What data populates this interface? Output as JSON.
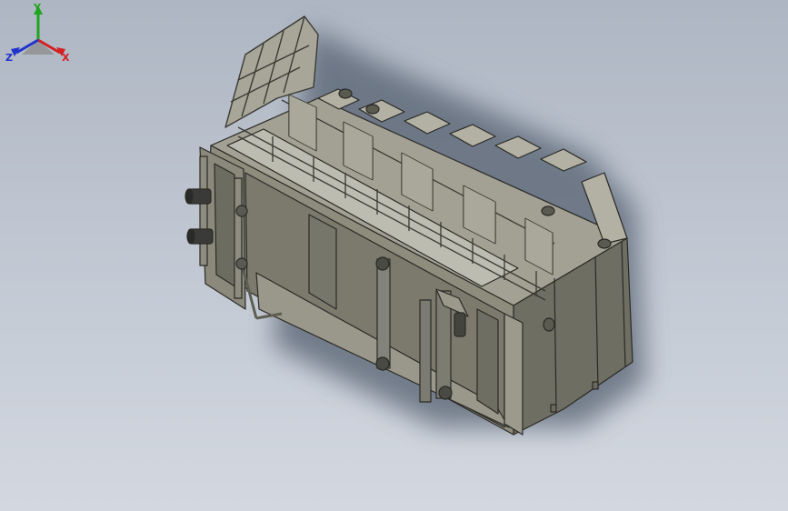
{
  "app": {
    "view_mode": "isometric-shaded-with-edges",
    "model_description_colors": {
      "tank_body": "#8e8c7d",
      "tank_dark": "#6a6a5e",
      "tank_light": "#b7b6a9",
      "outline": "#2a2a26",
      "shadow": "#56606f"
    }
  },
  "triad": {
    "x_label": "X",
    "y_label": "Y",
    "z_label": "Z",
    "x_color": "#d42020",
    "y_color": "#1fa51f",
    "z_color": "#2233cc"
  }
}
